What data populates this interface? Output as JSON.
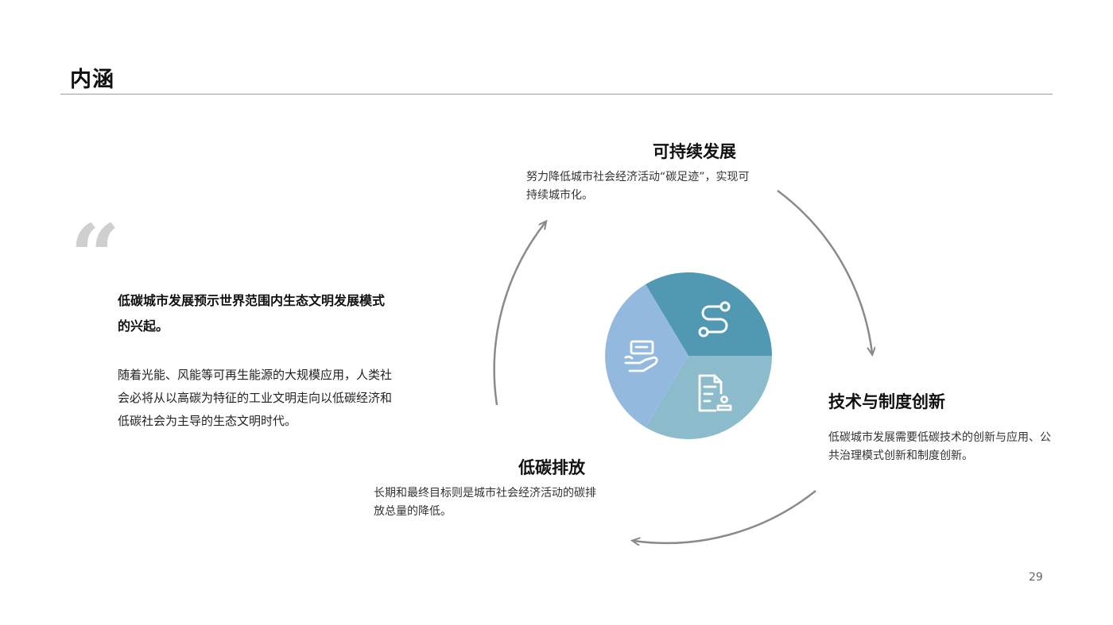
{
  "page": {
    "title": "内涵",
    "page_number": "29"
  },
  "quote": {
    "mark": "“",
    "headline": "低碳城市发展预示世界范围内生态文明发展模式的兴起。",
    "body": "随着光能、风能等可再生能源的大规模应用，人类社会必将从以高碳为特征的工业文明走向以低碳经济和低碳社会为主导的生态文明时代。"
  },
  "cycle": {
    "stages": [
      {
        "title": "可持续发展",
        "description": "努力降低城市社会经济活动“碳足迹”，实现可持续城市化。",
        "color": "#5198b2",
        "icon": "route-icon"
      },
      {
        "title": "技术与制度创新",
        "description": "低碳城市发展需要低碳技术的创新与应用、公共治理模式创新和制度创新。",
        "color": "#8cbccc",
        "icon": "document-stamp-icon"
      },
      {
        "title": "低碳排放",
        "description": "长期和最终目标则是城市社会经济活动的碳排放总量的降低。",
        "color": "#93bade",
        "icon": "hand-card-icon"
      }
    ],
    "arrow_color": "#8a8a8a",
    "icon_color": "#ffffff"
  }
}
